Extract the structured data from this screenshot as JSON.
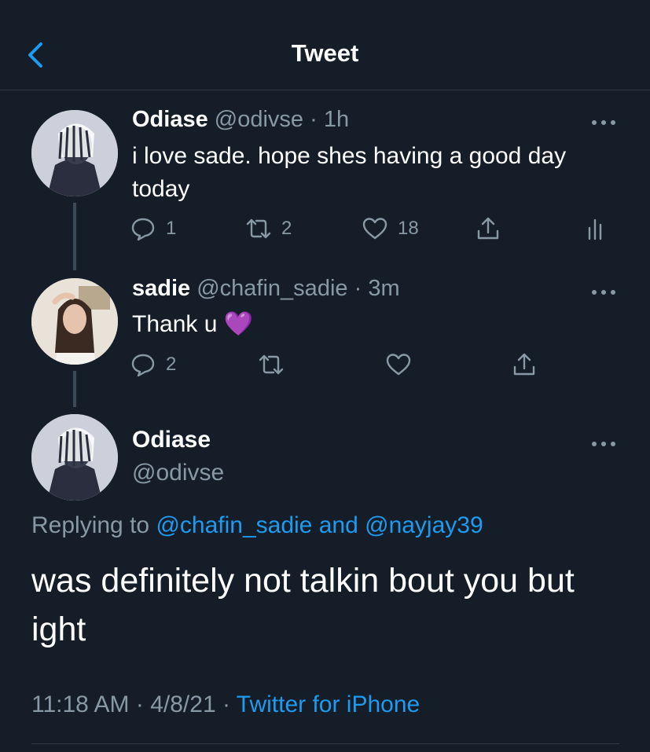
{
  "header": {
    "title": "Tweet"
  },
  "tweets": [
    {
      "name": "Odiase",
      "handle": "@odivse",
      "time": "1h",
      "text": "i love sade. hope shes having a good day today",
      "reply_count": "1",
      "retweet_count": "2",
      "like_count": "18"
    },
    {
      "name": "sadie",
      "handle": "@chafin_sadie",
      "time": "3m",
      "text": "Thank u",
      "emoji": "💜",
      "reply_count": "2"
    }
  ],
  "main_tweet": {
    "name": "Odiase",
    "handle": "@odivse",
    "replying_prefix": "Replying to",
    "replying_user1": "@chafin_sadie",
    "replying_and": "and",
    "replying_user2": "@nayjay39",
    "text": "was definitely not talkin bout you but ight",
    "time": "11:18 AM",
    "date": "4/8/21",
    "source": "Twitter for iPhone"
  },
  "colors": {
    "background": "#151d28",
    "accent": "#1d9bf0",
    "secondary_text": "#8899a6",
    "divider": "#2f3a46"
  },
  "icons": [
    "back-chevron-icon",
    "more-icon",
    "reply-icon",
    "retweet-icon",
    "like-icon",
    "share-icon",
    "analytics-icon"
  ]
}
